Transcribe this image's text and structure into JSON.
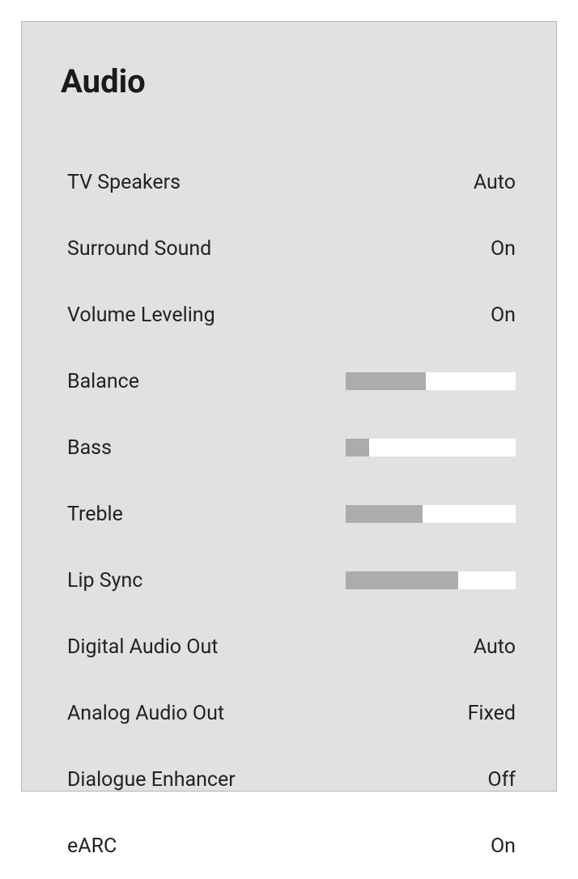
{
  "title": "Audio",
  "rows": [
    {
      "label": "TV Speakers",
      "type": "value",
      "value": "Auto"
    },
    {
      "label": "Surround Sound",
      "type": "value",
      "value": "On"
    },
    {
      "label": "Volume Leveling",
      "type": "value",
      "value": "On"
    },
    {
      "label": "Balance",
      "type": "slider",
      "percent": 47
    },
    {
      "label": "Bass",
      "type": "slider",
      "percent": 14
    },
    {
      "label": "Treble",
      "type": "slider",
      "percent": 45
    },
    {
      "label": "Lip Sync",
      "type": "slider",
      "percent": 66
    },
    {
      "label": "Digital Audio Out",
      "type": "value",
      "value": "Auto"
    },
    {
      "label": "Analog Audio Out",
      "type": "value",
      "value": "Fixed"
    },
    {
      "label": "Dialogue Enhancer",
      "type": "value",
      "value": "Off"
    },
    {
      "label": "eARC",
      "type": "value",
      "value": "On"
    }
  ]
}
